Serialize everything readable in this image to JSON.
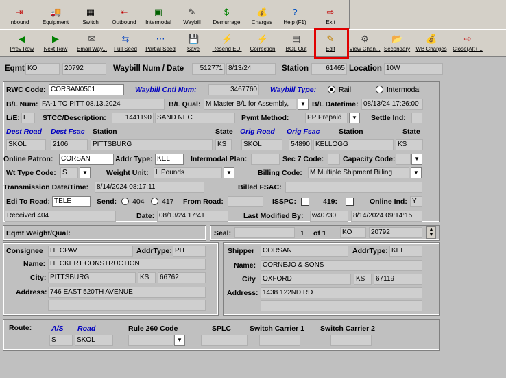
{
  "toolbar1": [
    {
      "name": "inbound",
      "label": "Inbound",
      "icon": "⇥",
      "color": "#c00000"
    },
    {
      "name": "equipment",
      "label": "Equipment",
      "icon": "🚚",
      "color": "#c06000"
    },
    {
      "name": "switch",
      "label": "Switch",
      "icon": "▦",
      "color": "#000"
    },
    {
      "name": "outbound",
      "label": "Outbound",
      "icon": "⇤",
      "color": "#c00000"
    },
    {
      "name": "intermodal",
      "label": "Intermodal",
      "icon": "▣",
      "color": "#006000"
    },
    {
      "name": "waybill",
      "label": "Waybill",
      "icon": "✎",
      "color": "#303030"
    },
    {
      "name": "demurrage",
      "label": "Demurrage",
      "icon": "$",
      "color": "#008000"
    },
    {
      "name": "charges",
      "label": "Charges",
      "icon": "💰",
      "color": "#008000"
    },
    {
      "name": "help",
      "label": "Help (F1)",
      "icon": "?",
      "color": "#0050c0"
    },
    {
      "name": "exit",
      "label": "Exit",
      "icon": "⇨",
      "color": "#c00000"
    }
  ],
  "toolbar2": [
    {
      "name": "prev-row",
      "label": "Prev Row",
      "icon": "◀",
      "color": "#008000"
    },
    {
      "name": "next-row",
      "label": "Next Row",
      "icon": "▶",
      "color": "#008000"
    },
    {
      "name": "email-waybill",
      "label": "Email Way...",
      "icon": "✉",
      "color": "#404040"
    },
    {
      "name": "full-seed",
      "label": "Full Seed",
      "icon": "⇆",
      "color": "#0040c0"
    },
    {
      "name": "partial-seed",
      "label": "Partial Seed",
      "icon": "⋯",
      "color": "#0040c0"
    },
    {
      "name": "save",
      "label": "Save",
      "icon": "💾",
      "color": "#000"
    },
    {
      "name": "resend-edi",
      "label": "Resend EDI",
      "icon": "⚡",
      "color": "#c0a000"
    },
    {
      "name": "correction",
      "label": "Correction",
      "icon": "⚡",
      "color": "#c0a000"
    },
    {
      "name": "bol-out",
      "label": "BOL Out",
      "icon": "▤",
      "color": "#404040"
    },
    {
      "name": "edit",
      "label": "Edit",
      "icon": "✎",
      "color": "#c08000"
    },
    {
      "name": "view-changes",
      "label": "View Chan...",
      "icon": "⚙",
      "color": "#404040"
    },
    {
      "name": "secondary",
      "label": "Secondary",
      "icon": "📂",
      "color": "#c09000"
    },
    {
      "name": "wb-charges",
      "label": "WB Charges",
      "icon": "💰",
      "color": "#008000"
    },
    {
      "name": "close",
      "label": "Close(Alt+...",
      "icon": "⇨",
      "color": "#c00000"
    }
  ],
  "header": {
    "eqmt_label": "Eqmt",
    "eqmt_init": "KO",
    "eqmt_num": "20792",
    "wb_label": "Waybill Num / Date",
    "wb_num": "512771",
    "wb_date": "8/13/24",
    "station_label": "Station",
    "station_code": "61465",
    "location_label": "Location",
    "location": "10W"
  },
  "form": {
    "rwc_label": "RWC Code:",
    "rwc": "CORSAN0501",
    "wb_cntl_label": "Waybill Cntl Num:",
    "wb_cntl": "3467760",
    "wb_type_label": "Waybill Type:",
    "rail": "Rail",
    "intermodal": "Intermodal",
    "bl_num_label": "B/L Num:",
    "bl_num": "FA-1 TO PITT 08.13.2024",
    "bl_qual_label": "B/L Qual:",
    "bl_qual": "M Master B/L for Assembly,",
    "bl_dt_label": "B/L Datetime:",
    "bl_dt": "08/13/24 17:26:00",
    "le_label": "L/E:",
    "le": "L",
    "stcc_label": "STCC/Description:",
    "stcc": "1441190",
    "stcc_desc": "SAND NEC",
    "pymt_label": "Pymt Method:",
    "pymt": "PP Prepaid",
    "settle_label": "Settle Ind:",
    "dest_road_label": "Dest Road",
    "dest_fsac_label": "Dest Fsac",
    "station_label": "Station",
    "state_label": "State",
    "orig_road_label": "Orig Road",
    "orig_fsac_label": "Orig Fsac",
    "station2_label": "Station",
    "state2_label": "State",
    "dest_road": "SKOL",
    "dest_fsac": "2106",
    "dest_station": "PITTSBURG",
    "dest_state": "KS",
    "orig_road": "SKOL",
    "orig_fsac": "54890",
    "orig_station": "KELLOGG",
    "orig_state": "KS",
    "online_label": "Online Patron:",
    "online": "CORSAN",
    "addr_type_label": "Addr Type:",
    "addr_type": "KEL",
    "intermodal_plan_label": "Intermodal Plan:",
    "sec7_label": "Sec 7 Code:",
    "capacity_label": "Capacity Code:",
    "wt_type_label": "Wt Type Code:",
    "wt_type": "S",
    "wt_unit_label": "Weight Unit:",
    "wt_unit": "L Pounds",
    "billing_label": "Billing Code:",
    "billing": "M Multiple Shipment Billing",
    "trans_label": "Transmission Date/Time:",
    "trans": "8/14/2024 08:17:11",
    "billed_label": "Billed FSAC:",
    "edi_road_label": "Edi To Road:",
    "edi_road": "TELE",
    "send_label": "Send:",
    "send_404": "404",
    "send_417": "417",
    "from_road_label": "From Road:",
    "isspc_label": "ISSPC:",
    "r419_label": "419:",
    "online_ind_label": "Online Ind:",
    "online_ind": "Y",
    "received": "Received 404",
    "date_label": "Date:",
    "date": "08/13/24 17:41",
    "last_mod_label": "Last Modified By:",
    "last_mod_user": "w40730",
    "last_mod_dt": "8/14/2024 09:14:15"
  },
  "weight": {
    "label": "Eqmt Weight/Qual:"
  },
  "seal": {
    "label": "Seal:",
    "page": "1",
    "of": "of 1",
    "init": "KO",
    "num": "20792"
  },
  "consignee": {
    "label": "Consignee",
    "code": "HECPAV",
    "addr_type_label": "AddrType:",
    "addr_type": "PIT",
    "name_label": "Name:",
    "name": "HECKERT CONSTRUCTION",
    "city_label": "City:",
    "city": "PITTSBURG",
    "state": "KS",
    "zip": "66762",
    "address_label": "Address:",
    "address": "746 EAST 520TH AVENUE"
  },
  "shipper": {
    "label": "Shipper",
    "code": "CORSAN",
    "addr_type_label": "AddrType:",
    "addr_type": "KEL",
    "name_label": "Name:",
    "name": "CORNEJO & SONS",
    "city_label": "City",
    "city": "OXFORD",
    "state": "KS",
    "zip": "67119",
    "address_label": "Address:",
    "address": "1438 122ND RD"
  },
  "route": {
    "label": "Route:",
    "as_label": "A/S",
    "road_label": "Road",
    "as": "S",
    "road": "SKOL",
    "rule260_label": "Rule 260 Code",
    "splc_label": "SPLC",
    "sc1_label": "Switch Carrier 1",
    "sc2_label": "Switch Carrier 2"
  },
  "colors": {
    "highlight": "#e00000",
    "blue_label": "#0000c0"
  }
}
